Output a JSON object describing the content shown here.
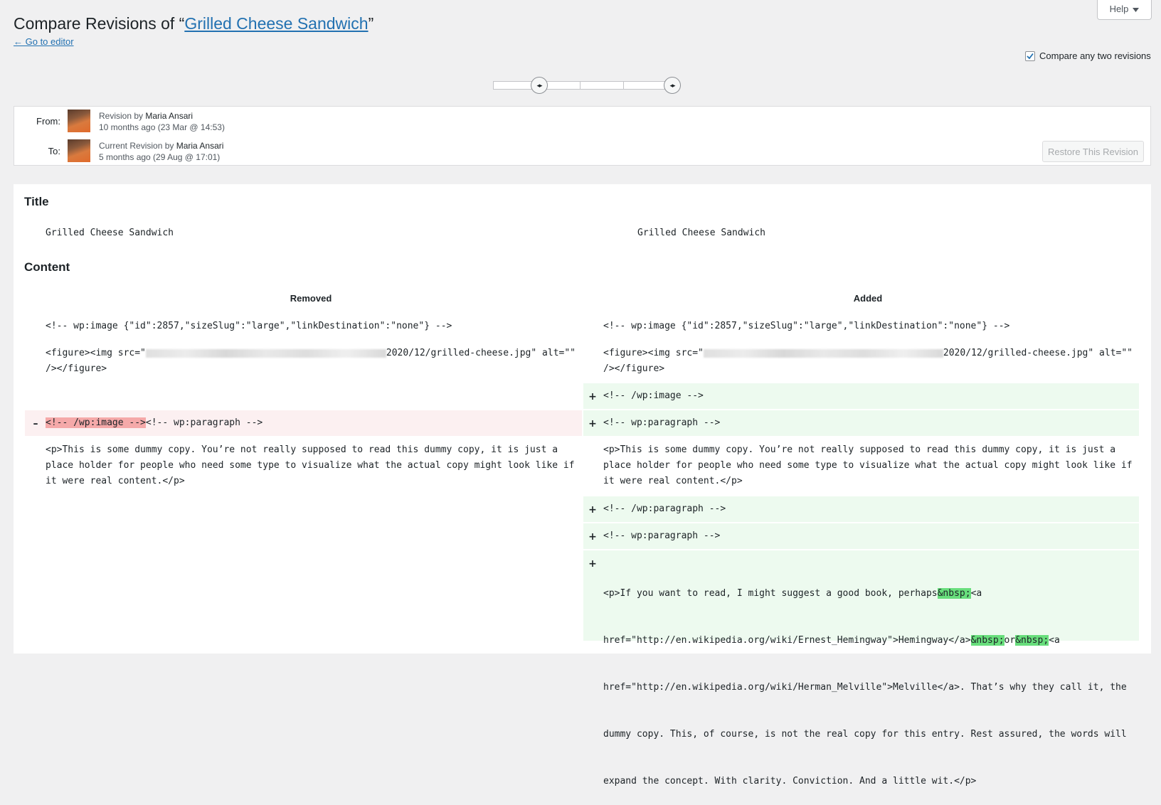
{
  "help": {
    "label": "Help",
    "icon": "caret-down-icon"
  },
  "title": {
    "prefix": "Compare Revisions of “",
    "post_title": "Grilled Cheese Sandwich",
    "suffix": "”"
  },
  "back_link": "← Go to editor",
  "compare_any": {
    "label": "Compare any two revisions",
    "checked": true
  },
  "slider": {
    "from_label": "◂▸",
    "to_label": "◂▸"
  },
  "meta": {
    "from": {
      "label": "From:",
      "prefix": "Revision by ",
      "author": "Maria Ansari",
      "time": "10 months ago (23 Mar @ 14:53)"
    },
    "to": {
      "label": "To:",
      "prefix": "Current Revision by ",
      "author": "Maria Ansari",
      "time": "5 months ago (29 Aug @ 17:01)"
    },
    "restore": "Restore This Revision"
  },
  "diff": {
    "title_heading": "Title",
    "title_left": "Grilled Cheese Sandwich",
    "title_right": "Grilled Cheese Sandwich",
    "content_heading": "Content",
    "removed_head": "Removed",
    "added_head": "Added",
    "image_block": "<!-- wp:image {\"id\":2857,\"sizeSlug\":\"large\",\"linkDestination\":\"none\"} -->",
    "figure_pre": "<figure><img src=\"",
    "figure_post": "2020/12/grilled-cheese.jpg\" alt=\"\"",
    "figure_close": "/></figure>",
    "wp_image_close": "<!-- /wp:image -->",
    "removed_hl": "<!-- /wp:image -->",
    "removed_rest": "<!-- wp:paragraph -->",
    "wp_paragraph_open": "<!-- wp:paragraph -->",
    "wp_paragraph_close": "<!-- /wp:paragraph -->",
    "para1_l1": "<p>This is some dummy copy. You’re not really supposed to read this dummy copy, it is just a",
    "para1_l2": "place holder for people who need some type to visualize what the actual copy might look like if",
    "para1_l3": "it were real content.</p>",
    "para2_l1_a": "<p>If you want to read, I might suggest a good book, perhaps",
    "nbsp": "&nbsp;",
    "para2_l1_b": "<a",
    "para2_l2_a": "href=\"http://en.wikipedia.org/wiki/Ernest_Hemingway\">Hemingway</a>",
    "para2_l2_or": "or",
    "para2_l2_b": "<a",
    "para2_l3": "href=\"http://en.wikipedia.org/wiki/Herman_Melville\">Melville</a>. That’s why they call it, the",
    "para2_l4": "dummy copy. This, of course, is not the real copy for this entry. Rest assured, the words will",
    "para2_l5": "expand the concept. With clarity. Conviction. And a little wit.</p>",
    "plus": "+",
    "minus": "–"
  }
}
